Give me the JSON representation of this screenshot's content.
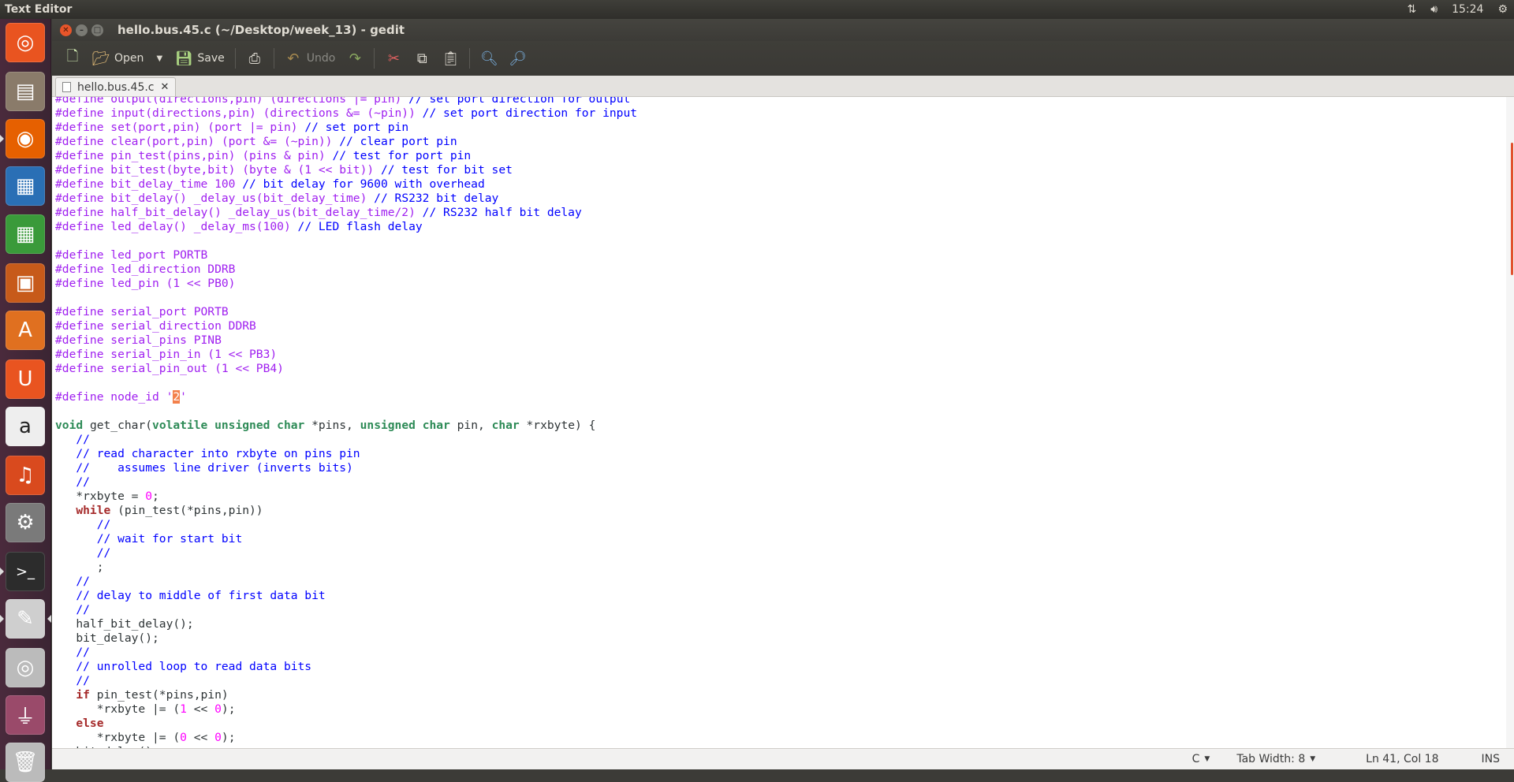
{
  "panel": {
    "app_title": "Text Editor",
    "clock": "15:24"
  },
  "window": {
    "title": "hello.bus.45.c (~/Desktop/week_13) - gedit"
  },
  "toolbar": {
    "open_label": "Open",
    "save_label": "Save",
    "undo_label": "Undo"
  },
  "tab": {
    "label": "hello.bus.45.c"
  },
  "status": {
    "language": "C",
    "tab_width": "Tab Width: 8",
    "position": "Ln 41, Col 18",
    "mode": "INS"
  },
  "code_lines": [
    [
      {
        "c": "pp",
        "t": "#define output(directions,pin) (directions |= pin) "
      },
      {
        "c": "cm",
        "t": "// set port direction for output"
      }
    ],
    [
      {
        "c": "pp",
        "t": "#define input(directions,pin) (directions &= (~pin)) "
      },
      {
        "c": "cm",
        "t": "// set port direction for input"
      }
    ],
    [
      {
        "c": "pp",
        "t": "#define set(port,pin) (port |= pin) "
      },
      {
        "c": "cm",
        "t": "// set port pin"
      }
    ],
    [
      {
        "c": "pp",
        "t": "#define clear(port,pin) (port &= (~pin)) "
      },
      {
        "c": "cm",
        "t": "// clear port pin"
      }
    ],
    [
      {
        "c": "pp",
        "t": "#define pin_test(pins,pin) (pins & pin) "
      },
      {
        "c": "cm",
        "t": "// test for port pin"
      }
    ],
    [
      {
        "c": "pp",
        "t": "#define bit_test(byte,bit) (byte & (1 << bit)) "
      },
      {
        "c": "cm",
        "t": "// test for bit set"
      }
    ],
    [
      {
        "c": "pp",
        "t": "#define bit_delay_time 100 "
      },
      {
        "c": "cm",
        "t": "// bit delay for 9600 with overhead"
      }
    ],
    [
      {
        "c": "pp",
        "t": "#define bit_delay() _delay_us(bit_delay_time) "
      },
      {
        "c": "cm",
        "t": "// RS232 bit delay"
      }
    ],
    [
      {
        "c": "pp",
        "t": "#define half_bit_delay() _delay_us(bit_delay_time/2) "
      },
      {
        "c": "cm",
        "t": "// RS232 half bit delay"
      }
    ],
    [
      {
        "c": "pp",
        "t": "#define led_delay() _delay_ms(100) "
      },
      {
        "c": "cm",
        "t": "// LED flash delay"
      }
    ],
    [],
    [
      {
        "c": "pp",
        "t": "#define led_port PORTB"
      }
    ],
    [
      {
        "c": "pp",
        "t": "#define led_direction DDRB"
      }
    ],
    [
      {
        "c": "pp",
        "t": "#define led_pin (1 << PB0)"
      }
    ],
    [],
    [
      {
        "c": "pp",
        "t": "#define serial_port PORTB"
      }
    ],
    [
      {
        "c": "pp",
        "t": "#define serial_direction DDRB"
      }
    ],
    [
      {
        "c": "pp",
        "t": "#define serial_pins PINB"
      }
    ],
    [
      {
        "c": "pp",
        "t": "#define serial_pin_in (1 << PB3)"
      }
    ],
    [
      {
        "c": "pp",
        "t": "#define serial_pin_out (1 << PB4)"
      }
    ],
    [],
    [
      {
        "c": "pp",
        "t": "#define node_id '"
      },
      {
        "c": "cursor-ch",
        "t": "2"
      },
      {
        "c": "pp",
        "t": "'"
      }
    ],
    [],
    [
      {
        "c": "ty",
        "t": "void"
      },
      {
        "c": "",
        "t": " get_char("
      },
      {
        "c": "ty",
        "t": "volatile unsigned char"
      },
      {
        "c": "",
        "t": " *pins, "
      },
      {
        "c": "ty",
        "t": "unsigned char"
      },
      {
        "c": "",
        "t": " pin, "
      },
      {
        "c": "ty",
        "t": "char"
      },
      {
        "c": "",
        "t": " *rxbyte) {"
      }
    ],
    [
      {
        "c": "",
        "t": "   "
      },
      {
        "c": "cm",
        "t": "//"
      }
    ],
    [
      {
        "c": "",
        "t": "   "
      },
      {
        "c": "cm",
        "t": "// read character into rxbyte on pins pin"
      }
    ],
    [
      {
        "c": "",
        "t": "   "
      },
      {
        "c": "cm",
        "t": "//    assumes line driver (inverts bits)"
      }
    ],
    [
      {
        "c": "",
        "t": "   "
      },
      {
        "c": "cm",
        "t": "//"
      }
    ],
    [
      {
        "c": "",
        "t": "   *rxbyte = "
      },
      {
        "c": "num",
        "t": "0"
      },
      {
        "c": "",
        "t": ";"
      }
    ],
    [
      {
        "c": "",
        "t": "   "
      },
      {
        "c": "kw",
        "t": "while"
      },
      {
        "c": "",
        "t": " (pin_test(*pins,pin))"
      }
    ],
    [
      {
        "c": "",
        "t": "      "
      },
      {
        "c": "cm",
        "t": "//"
      }
    ],
    [
      {
        "c": "",
        "t": "      "
      },
      {
        "c": "cm",
        "t": "// wait for start bit"
      }
    ],
    [
      {
        "c": "",
        "t": "      "
      },
      {
        "c": "cm",
        "t": "//"
      }
    ],
    [
      {
        "c": "",
        "t": "      ;"
      }
    ],
    [
      {
        "c": "",
        "t": "   "
      },
      {
        "c": "cm",
        "t": "//"
      }
    ],
    [
      {
        "c": "",
        "t": "   "
      },
      {
        "c": "cm",
        "t": "// delay to middle of first data bit"
      }
    ],
    [
      {
        "c": "",
        "t": "   "
      },
      {
        "c": "cm",
        "t": "//"
      }
    ],
    [
      {
        "c": "",
        "t": "   half_bit_delay();"
      }
    ],
    [
      {
        "c": "",
        "t": "   bit_delay();"
      }
    ],
    [
      {
        "c": "",
        "t": "   "
      },
      {
        "c": "cm",
        "t": "//"
      }
    ],
    [
      {
        "c": "",
        "t": "   "
      },
      {
        "c": "cm",
        "t": "// unrolled loop to read data bits"
      }
    ],
    [
      {
        "c": "",
        "t": "   "
      },
      {
        "c": "cm",
        "t": "//"
      }
    ],
    [
      {
        "c": "",
        "t": "   "
      },
      {
        "c": "kw",
        "t": "if"
      },
      {
        "c": "",
        "t": " pin_test(*pins,pin)"
      }
    ],
    [
      {
        "c": "",
        "t": "      *rxbyte |= ("
      },
      {
        "c": "num",
        "t": "1"
      },
      {
        "c": "",
        "t": " << "
      },
      {
        "c": "num",
        "t": "0"
      },
      {
        "c": "",
        "t": ");"
      }
    ],
    [
      {
        "c": "",
        "t": "   "
      },
      {
        "c": "kw",
        "t": "else"
      }
    ],
    [
      {
        "c": "",
        "t": "      *rxbyte |= ("
      },
      {
        "c": "num",
        "t": "0"
      },
      {
        "c": "",
        "t": " << "
      },
      {
        "c": "num",
        "t": "0"
      },
      {
        "c": "",
        "t": ");"
      }
    ],
    [
      {
        "c": "",
        "t": "   bit_delay();"
      }
    ]
  ],
  "launcher": [
    {
      "name": "ubuntu-dash-icon",
      "glyph": "◎",
      "color": "#e95420"
    },
    {
      "name": "files-icon",
      "glyph": "▤",
      "color": "#8a7b6a"
    },
    {
      "name": "firefox-icon",
      "glyph": "◉",
      "color": "#e66000"
    },
    {
      "name": "writer-icon",
      "glyph": "▦",
      "color": "#2a6fb5"
    },
    {
      "name": "calc-icon",
      "glyph": "▦",
      "color": "#3a9a3a"
    },
    {
      "name": "impress-icon",
      "glyph": "▣",
      "color": "#c75a1a"
    },
    {
      "name": "software-center-icon",
      "glyph": "A",
      "color": "#e07020"
    },
    {
      "name": "ubuntu-one-icon",
      "glyph": "U",
      "color": "#e95420"
    },
    {
      "name": "amazon-icon",
      "glyph": "a",
      "color": "#eeeeee"
    },
    {
      "name": "ubuntu-one-music-icon",
      "glyph": "♫",
      "color": "#d94a1e"
    },
    {
      "name": "system-settings-icon",
      "glyph": "⚙",
      "color": "#7a7a7a"
    },
    {
      "name": "terminal-icon",
      "glyph": ">_",
      "color": "#2c2c2c"
    },
    {
      "name": "text-editor-icon",
      "glyph": "✎",
      "color": "#cfcfcf"
    },
    {
      "name": "dvd-icon",
      "glyph": "◎",
      "color": "#bbbbbb"
    },
    {
      "name": "usb-drive-icon",
      "glyph": "⏚",
      "color": "#9a4a6a"
    },
    {
      "name": "trash-icon",
      "glyph": "🗑",
      "color": "#bbbbbb"
    }
  ]
}
